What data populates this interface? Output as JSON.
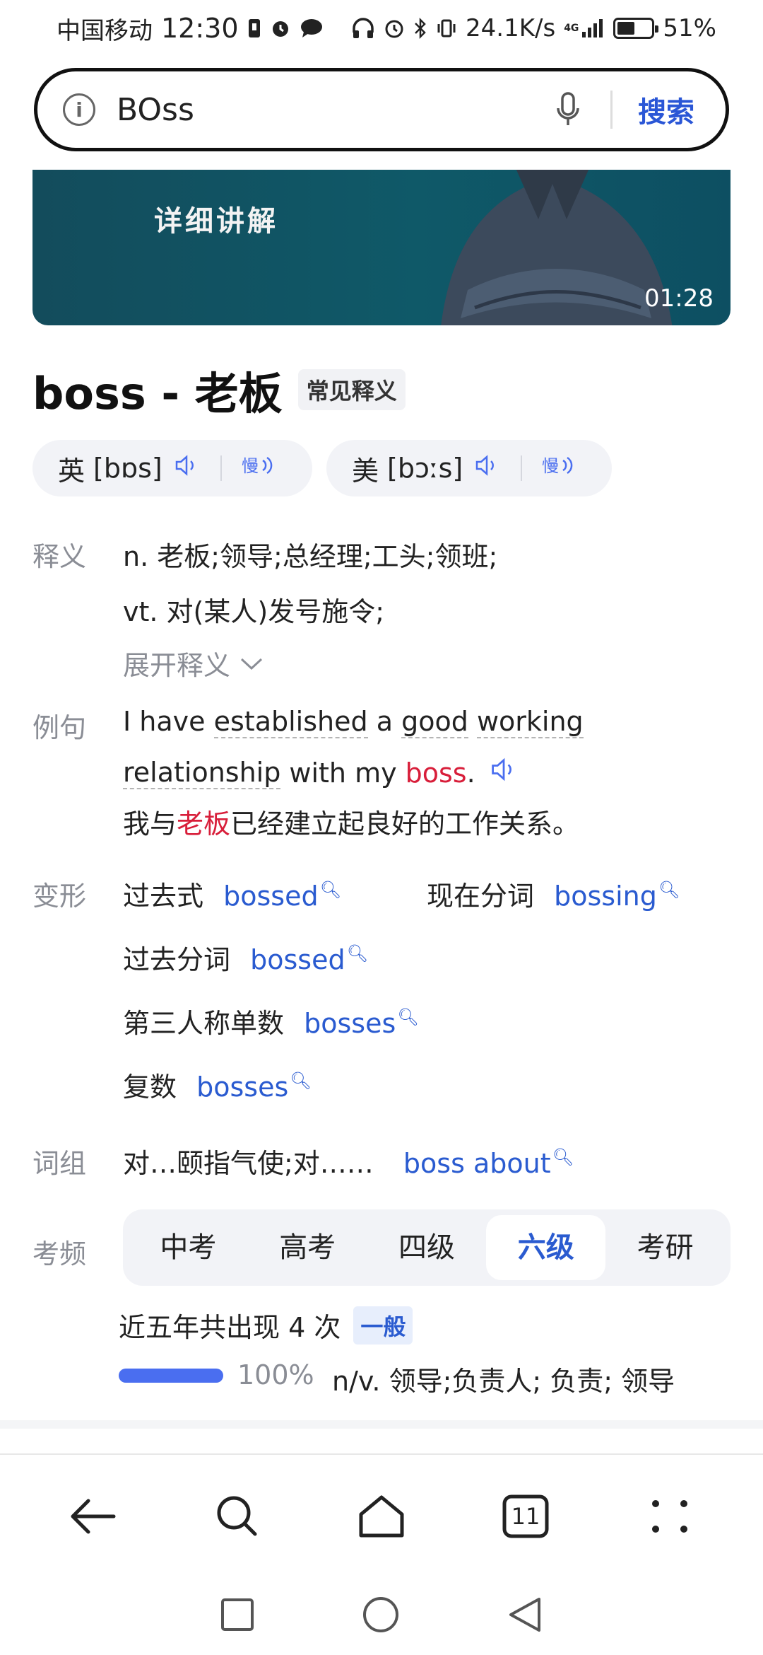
{
  "status_bar": {
    "carrier": "中国移动",
    "time": "12:30",
    "speed": "24.1K/s",
    "network": "4G",
    "battery": "51%",
    "battery_level": 0.51
  },
  "search": {
    "query": "BOss",
    "button_label": "搜索"
  },
  "video": {
    "title": "详细讲解",
    "duration": "01:28"
  },
  "entry": {
    "headword": "boss - 老板",
    "badge": "常见释义",
    "phonetics": [
      {
        "region": "英",
        "ipa": "[bɒs]"
      },
      {
        "region": "美",
        "ipa": "[bɔːs]"
      }
    ],
    "definition_label": "释义",
    "definitions": [
      "n. 老板;领导;总经理;工头;领班;",
      "vt. 对(某人)发号施令;"
    ],
    "expand_label": "展开释义",
    "example_label": "例句",
    "example": {
      "w1": "I have",
      "w2": "established",
      "w3": "a",
      "w4": "good",
      "w5": "working",
      "w6": "relationship",
      "w7": "with my",
      "w8": "boss",
      "w9": ".",
      "zh_before": "我与",
      "zh_hl": "老板",
      "zh_after": "已经建立起良好的工作关系。"
    },
    "forms_label": "变形",
    "forms": [
      {
        "label": "过去式",
        "word": "bossed"
      },
      {
        "label": "现在分词",
        "word": "bossing"
      },
      {
        "label": "过去分词",
        "word": "bossed"
      },
      {
        "label": "第三人称单数",
        "word": "bosses"
      },
      {
        "label": "复数",
        "word": "bosses"
      }
    ],
    "phrase_label": "词组",
    "phrase_zh": "对…颐指气使;对……",
    "phrase_en": "boss about",
    "exam_label": "考频",
    "exam_tabs": [
      "中考",
      "高考",
      "四级",
      "六级",
      "考研"
    ],
    "exam_active": "六级",
    "freq_text": "近五年共出现 4 次",
    "freq_badge": "一般",
    "freq_pct_value": 1.0,
    "freq_pct": "100%",
    "freq_def": "n/v. 领导;负责人; 负责; 领导"
  },
  "nav": {
    "tab_count": "11"
  }
}
